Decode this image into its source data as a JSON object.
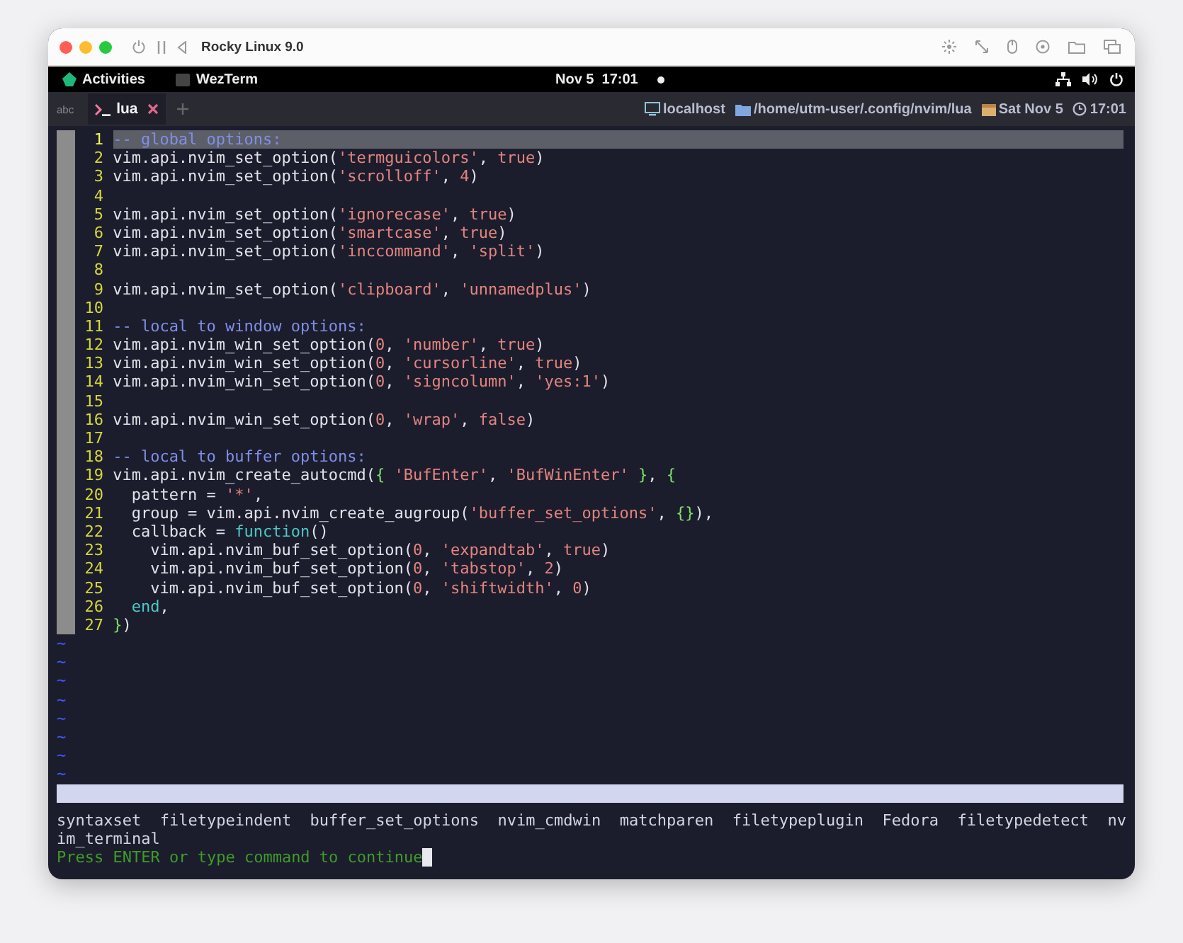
{
  "window": {
    "title": "Rocky Linux 9.0"
  },
  "top_bar": {
    "activities": "Activities",
    "app": "WezTerm",
    "date": "Nov 5",
    "time": "17:01"
  },
  "tab_bar": {
    "left_label": "abc",
    "tabs": [
      {
        "label": "lua",
        "selected": true
      }
    ],
    "status": [
      {
        "kind": "host",
        "text": "localhost"
      },
      {
        "kind": "folder",
        "text": "/home/utm-user/.config/nvim/lua"
      },
      {
        "kind": "date",
        "text": "Sat Nov 5"
      },
      {
        "kind": "clock",
        "text": "17:01"
      }
    ]
  },
  "editor": {
    "lines": [
      {
        "number": "1",
        "current": true,
        "tokens": [
          {
            "kind": "comment",
            "text": "-- global options:"
          }
        ]
      },
      {
        "number": "2",
        "current": false,
        "tokens": [
          {
            "kind": "plain",
            "text": "vim.api.nvim_set_option("
          },
          {
            "kind": "string",
            "text": "'termguicolors'"
          },
          {
            "kind": "plain",
            "text": ", "
          },
          {
            "kind": "constant",
            "text": "true"
          },
          {
            "kind": "plain",
            "text": ")"
          }
        ]
      },
      {
        "number": "3",
        "current": false,
        "tokens": [
          {
            "kind": "plain",
            "text": "vim.api.nvim_set_option("
          },
          {
            "kind": "string",
            "text": "'scrolloff'"
          },
          {
            "kind": "plain",
            "text": ", "
          },
          {
            "kind": "constant",
            "text": "4"
          },
          {
            "kind": "plain",
            "text": ")"
          }
        ]
      },
      {
        "number": "4",
        "current": false
      },
      {
        "number": "5",
        "current": false,
        "tokens": [
          {
            "kind": "plain",
            "text": "vim.api.nvim_set_option("
          },
          {
            "kind": "string",
            "text": "'ignorecase'"
          },
          {
            "kind": "plain",
            "text": ", "
          },
          {
            "kind": "constant",
            "text": "true"
          },
          {
            "kind": "plain",
            "text": ")"
          }
        ]
      },
      {
        "number": "6",
        "current": false,
        "tokens": [
          {
            "kind": "plain",
            "text": "vim.api.nvim_set_option("
          },
          {
            "kind": "string",
            "text": "'smartcase'"
          },
          {
            "kind": "plain",
            "text": ", "
          },
          {
            "kind": "constant",
            "text": "true"
          },
          {
            "kind": "plain",
            "text": ")"
          }
        ]
      },
      {
        "number": "7",
        "current": false,
        "tokens": [
          {
            "kind": "plain",
            "text": "vim.api.nvim_set_option("
          },
          {
            "kind": "string",
            "text": "'inccommand'"
          },
          {
            "kind": "plain",
            "text": ", "
          },
          {
            "kind": "string",
            "text": "'split'"
          },
          {
            "kind": "plain",
            "text": ")"
          }
        ]
      },
      {
        "number": "8",
        "current": false
      },
      {
        "number": "9",
        "current": false,
        "tokens": [
          {
            "kind": "plain",
            "text": "vim.api.nvim_set_option("
          },
          {
            "kind": "string",
            "text": "'clipboard'"
          },
          {
            "kind": "plain",
            "text": ", "
          },
          {
            "kind": "string",
            "text": "'unnamedplus'"
          },
          {
            "kind": "plain",
            "text": ")"
          }
        ]
      },
      {
        "number": "10",
        "current": false
      },
      {
        "number": "11",
        "current": false,
        "tokens": [
          {
            "kind": "comment",
            "text": "-- local to window options:"
          }
        ]
      },
      {
        "number": "12",
        "current": false,
        "tokens": [
          {
            "kind": "plain",
            "text": "vim.api.nvim_win_set_option("
          },
          {
            "kind": "constant",
            "text": "0"
          },
          {
            "kind": "plain",
            "text": ", "
          },
          {
            "kind": "string",
            "text": "'number'"
          },
          {
            "kind": "plain",
            "text": ", "
          },
          {
            "kind": "constant",
            "text": "true"
          },
          {
            "kind": "plain",
            "text": ")"
          }
        ]
      },
      {
        "number": "13",
        "current": false,
        "tokens": [
          {
            "kind": "plain",
            "text": "vim.api.nvim_win_set_option("
          },
          {
            "kind": "constant",
            "text": "0"
          },
          {
            "kind": "plain",
            "text": ", "
          },
          {
            "kind": "string",
            "text": "'cursorline'"
          },
          {
            "kind": "plain",
            "text": ", "
          },
          {
            "kind": "constant",
            "text": "true"
          },
          {
            "kind": "plain",
            "text": ")"
          }
        ]
      },
      {
        "number": "14",
        "current": false,
        "tokens": [
          {
            "kind": "plain",
            "text": "vim.api.nvim_win_set_option("
          },
          {
            "kind": "constant",
            "text": "0"
          },
          {
            "kind": "plain",
            "text": ", "
          },
          {
            "kind": "string",
            "text": "'signcolumn'"
          },
          {
            "kind": "plain",
            "text": ", "
          },
          {
            "kind": "string",
            "text": "'yes:1'"
          },
          {
            "kind": "plain",
            "text": ")"
          }
        ]
      },
      {
        "number": "15",
        "current": false
      },
      {
        "number": "16",
        "current": false,
        "tokens": [
          {
            "kind": "plain",
            "text": "vim.api.nvim_win_set_option("
          },
          {
            "kind": "constant",
            "text": "0"
          },
          {
            "kind": "plain",
            "text": ", "
          },
          {
            "kind": "string",
            "text": "'wrap'"
          },
          {
            "kind": "plain",
            "text": ", "
          },
          {
            "kind": "constant",
            "text": "false"
          },
          {
            "kind": "plain",
            "text": ")"
          }
        ]
      },
      {
        "number": "17",
        "current": false
      },
      {
        "number": "18",
        "current": false,
        "tokens": [
          {
            "kind": "comment",
            "text": "-- local to buffer options:"
          }
        ]
      },
      {
        "number": "19",
        "current": false,
        "tokens": [
          {
            "kind": "plain",
            "text": "vim.api.nvim_create_autocmd("
          },
          {
            "kind": "brace",
            "text": "{"
          },
          {
            "kind": "string",
            "text": " 'BufEnter'"
          },
          {
            "kind": "plain",
            "text": ", "
          },
          {
            "kind": "string",
            "text": "'BufWinEnter'"
          },
          {
            "kind": "brace",
            "text": " }"
          },
          {
            "kind": "plain",
            "text": ", "
          },
          {
            "kind": "brace",
            "text": "{"
          }
        ]
      },
      {
        "number": "20",
        "current": false,
        "tokens": [
          {
            "kind": "plain",
            "text": "  pattern = "
          },
          {
            "kind": "string",
            "text": "'*'"
          },
          {
            "kind": "plain",
            "text": ","
          }
        ]
      },
      {
        "number": "21",
        "current": false,
        "tokens": [
          {
            "kind": "plain",
            "text": "  group = vim.api.nvim_create_augroup("
          },
          {
            "kind": "string",
            "text": "'buffer_set_options'"
          },
          {
            "kind": "plain",
            "text": ", "
          },
          {
            "kind": "brace",
            "text": "{}"
          },
          {
            "kind": "plain",
            "text": "),"
          }
        ]
      },
      {
        "number": "22",
        "current": false,
        "tokens": [
          {
            "kind": "plain",
            "text": "  callback = "
          },
          {
            "kind": "keyword",
            "text": "function"
          },
          {
            "kind": "plain",
            "text": "()"
          }
        ]
      },
      {
        "number": "23",
        "current": false,
        "tokens": [
          {
            "kind": "plain",
            "text": "    vim.api.nvim_buf_set_option("
          },
          {
            "kind": "constant",
            "text": "0"
          },
          {
            "kind": "plain",
            "text": ", "
          },
          {
            "kind": "string",
            "text": "'expandtab'"
          },
          {
            "kind": "plain",
            "text": ", "
          },
          {
            "kind": "constant",
            "text": "true"
          },
          {
            "kind": "plain",
            "text": ")"
          }
        ]
      },
      {
        "number": "24",
        "current": false,
        "tokens": [
          {
            "kind": "plain",
            "text": "    vim.api.nvim_buf_set_option("
          },
          {
            "kind": "constant",
            "text": "0"
          },
          {
            "kind": "plain",
            "text": ", "
          },
          {
            "kind": "string",
            "text": "'tabstop'"
          },
          {
            "kind": "plain",
            "text": ", "
          },
          {
            "kind": "constant",
            "text": "2"
          },
          {
            "kind": "plain",
            "text": ")"
          }
        ]
      },
      {
        "number": "25",
        "current": false,
        "tokens": [
          {
            "kind": "plain",
            "text": "    vim.api.nvim_buf_set_option("
          },
          {
            "kind": "constant",
            "text": "0"
          },
          {
            "kind": "plain",
            "text": ", "
          },
          {
            "kind": "string",
            "text": "'shiftwidth'"
          },
          {
            "kind": "plain",
            "text": ", "
          },
          {
            "kind": "constant",
            "text": "0"
          },
          {
            "kind": "plain",
            "text": ")"
          }
        ]
      },
      {
        "number": "26",
        "current": false,
        "tokens": [
          {
            "kind": "keyword",
            "text": "  end"
          },
          {
            "kind": "plain",
            "text": ","
          }
        ]
      },
      {
        "number": "27",
        "current": false,
        "tokens": [
          {
            "kind": "brace",
            "text": "}"
          },
          {
            "kind": "plain",
            "text": ")"
          }
        ]
      }
    ],
    "empty_markers": [
      "~",
      "~",
      "~",
      "~",
      "~",
      "~",
      "~",
      "~"
    ]
  },
  "message": {
    "lines": [
      "syntaxset  filetypeindent  buffer_set_options  nvim_cmdwin  matchparen  filetypeplugin  Fedora  filetypedetect  nv",
      "im_terminal"
    ],
    "prompt": "Press ENTER or type command to continue"
  }
}
